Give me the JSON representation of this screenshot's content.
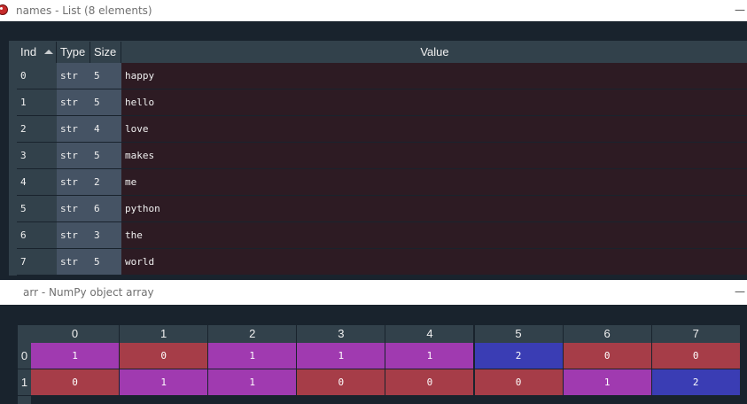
{
  "window1": {
    "title": "names - List (8 elements)",
    "minimize_glyph": "—",
    "columns": [
      "Ind",
      "Type",
      "Size",
      "Value"
    ],
    "rows": [
      {
        "index": "0",
        "type": "str",
        "size": "5",
        "value": "happy"
      },
      {
        "index": "1",
        "type": "str",
        "size": "5",
        "value": "hello"
      },
      {
        "index": "2",
        "type": "str",
        "size": "4",
        "value": "love"
      },
      {
        "index": "3",
        "type": "str",
        "size": "5",
        "value": "makes"
      },
      {
        "index": "4",
        "type": "str",
        "size": "2",
        "value": "me"
      },
      {
        "index": "5",
        "type": "str",
        "size": "6",
        "value": "python"
      },
      {
        "index": "6",
        "type": "str",
        "size": "3",
        "value": "the"
      },
      {
        "index": "7",
        "type": "str",
        "size": "5",
        "value": "world"
      }
    ]
  },
  "window2": {
    "title": "arr - NumPy object array",
    "minimize_glyph": "—",
    "col_headers": [
      "0",
      "1",
      "2",
      "3",
      "4",
      "5",
      "6",
      "7"
    ],
    "row_headers": [
      "0",
      "1"
    ],
    "cells": [
      [
        "1",
        "0",
        "1",
        "1",
        "1",
        "2",
        "0",
        "0"
      ],
      [
        "0",
        "1",
        "1",
        "0",
        "0",
        "0",
        "1",
        "2"
      ]
    ]
  },
  "colors": {
    "background": "#19232d",
    "header": "#32414b",
    "value_cell": "#2d1b23",
    "value_0": "#a63d48",
    "value_1": "#a03ab0",
    "value_2": "#3a3db4"
  },
  "icons": {
    "app": "spyder-icon",
    "sort": "sort-ascending-icon"
  }
}
